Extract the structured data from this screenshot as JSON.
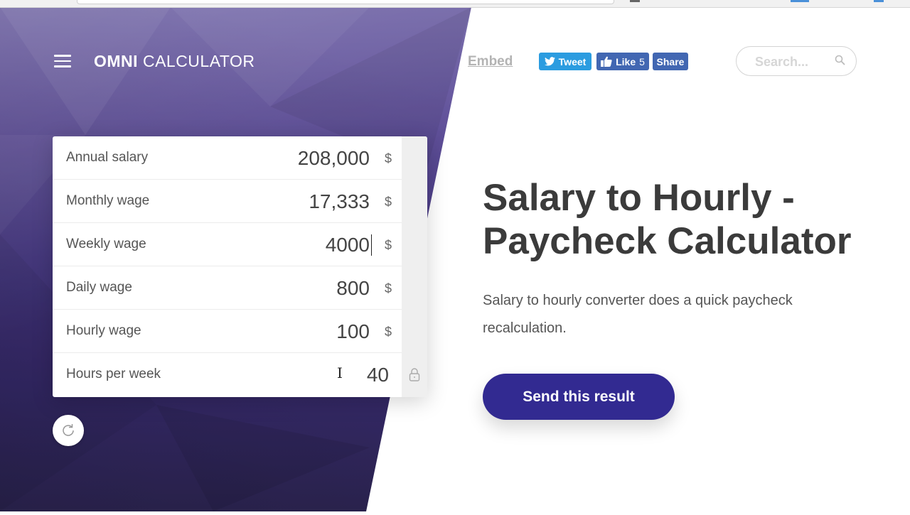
{
  "header": {
    "menu_icon": "hamburger-menu-icon",
    "logo_bold": "OMNI",
    "logo_light": "CALCULATOR",
    "embed_label": "Embed",
    "tweet_label": "Tweet",
    "like_label": "Like",
    "like_count": "5",
    "share_label": "Share",
    "search": {
      "placeholder": "Search...",
      "value": "",
      "icon": "search-icon"
    }
  },
  "calculator": {
    "rows": [
      {
        "label": "Annual salary",
        "value": "208,000",
        "unit": "$"
      },
      {
        "label": "Monthly wage",
        "value": "17,333",
        "unit": "$"
      },
      {
        "label": "Weekly wage",
        "value": "4000",
        "unit": "$",
        "focused": true
      },
      {
        "label": "Daily wage",
        "value": "800",
        "unit": "$"
      },
      {
        "label": "Hourly wage",
        "value": "100",
        "unit": "$"
      },
      {
        "label": "Hours per week",
        "value": "40",
        "unit": "",
        "locked": true
      }
    ],
    "reset_icon": "refresh-icon"
  },
  "main": {
    "title": "Salary to Hourly - Paycheck Calculator",
    "description": "Salary to hourly converter does a quick paycheck recalculation.",
    "send_button": "Send this result"
  },
  "colors": {
    "brand_purple": "#322a91",
    "twitter_blue": "#2b9ce0",
    "facebook_blue": "#4267b2"
  }
}
